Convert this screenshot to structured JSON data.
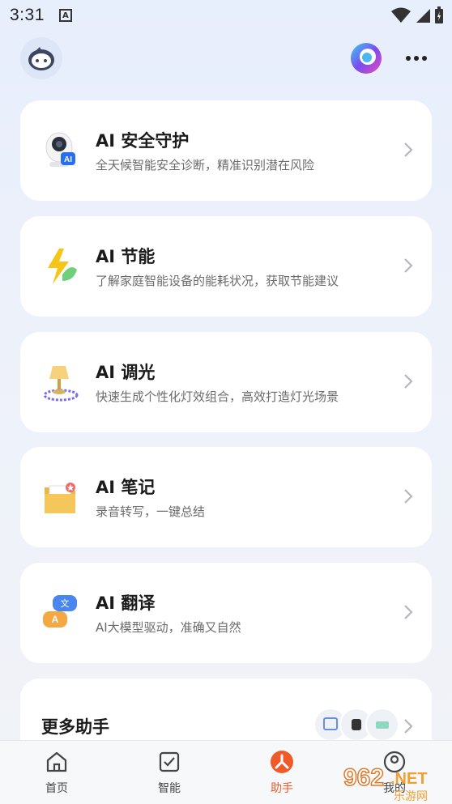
{
  "status_bar": {
    "time": "3:31",
    "notification_glyph": "A"
  },
  "header": {
    "avatar_icon": "robot-avatar-icon",
    "logo_icon": "assistant-logo-icon",
    "more_icon": "more-dots-icon"
  },
  "cards": [
    {
      "title": "AI 安全守护",
      "desc": "全天候智能安全诊断，精准识别潜在风险",
      "icon": "security-camera-icon"
    },
    {
      "title": "AI 节能",
      "desc": "了解家庭智能设备的能耗状况，获取节能建议",
      "icon": "energy-bolt-icon"
    },
    {
      "title": "AI 调光",
      "desc": "快速生成个性化灯效组合，高效打造灯光场景",
      "icon": "lamp-light-icon"
    },
    {
      "title": "AI 笔记",
      "desc": "录音转写，一键总结",
      "icon": "note-folder-icon"
    },
    {
      "title": "AI 翻译",
      "desc": "AI大模型驱动，准确又自然",
      "icon": "translate-bubble-icon"
    }
  ],
  "more_assistants": {
    "title": "更多助手"
  },
  "tabs": [
    {
      "label": "首页",
      "icon": "home-icon"
    },
    {
      "label": "智能",
      "icon": "check-square-icon"
    },
    {
      "label": "助手",
      "icon": "assistant-icon",
      "active": true
    },
    {
      "label": "我的",
      "icon": "profile-icon"
    }
  ],
  "watermark": {
    "text": "962.NET",
    "subtext": "乐游网"
  },
  "colors": {
    "accent": "#f05a28",
    "card_bg": "#ffffff",
    "bg": "#eaf0fb"
  }
}
